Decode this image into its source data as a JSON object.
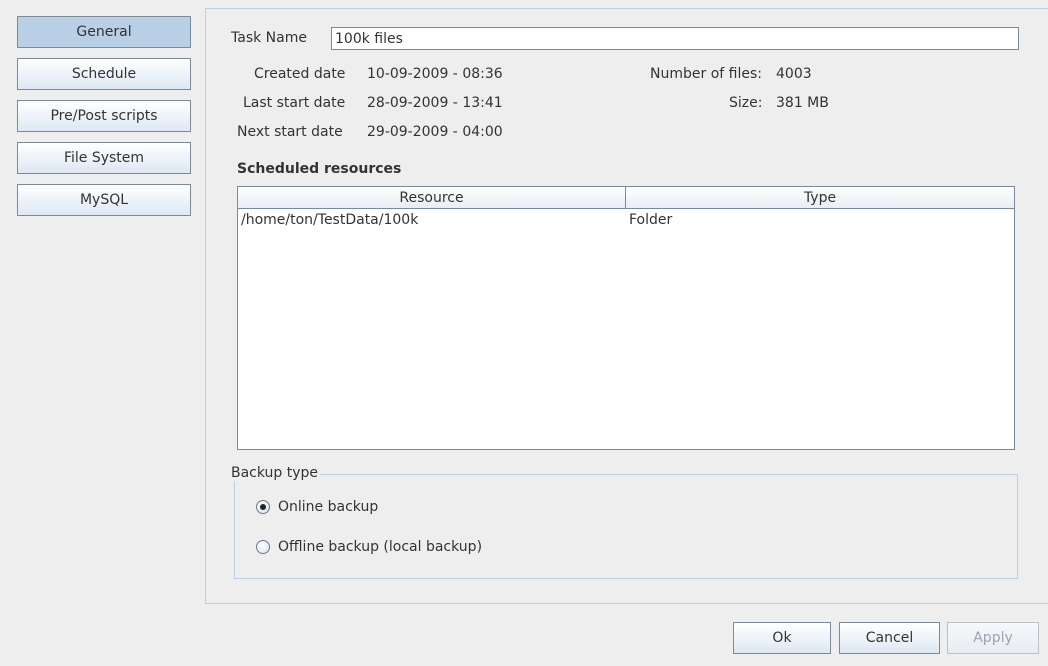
{
  "sidebar": {
    "items": [
      {
        "label": "General",
        "active": true
      },
      {
        "label": "Schedule",
        "active": false
      },
      {
        "label": "Pre/Post scripts",
        "active": false
      },
      {
        "label": "File System",
        "active": false
      },
      {
        "label": "MySQL",
        "active": false
      }
    ]
  },
  "general": {
    "task_name_label": "Task Name",
    "task_name_value": "100k files",
    "created_label": "Created date",
    "created_value": "10-09-2009 - 08:36",
    "last_start_label": "Last start date",
    "last_start_value": "28-09-2009 - 13:41",
    "next_start_label": "Next start date",
    "next_start_value": "29-09-2009 - 04:00",
    "num_files_label": "Number of files:",
    "num_files_value": "4003",
    "size_label": "Size:",
    "size_value": "381 MB"
  },
  "resources": {
    "title": "Scheduled resources",
    "columns": [
      "Resource",
      "Type"
    ],
    "rows": [
      {
        "resource": "/home/ton/TestData/100k",
        "type": "Folder"
      }
    ]
  },
  "backup_type": {
    "legend": "Backup type",
    "options": [
      {
        "label": "Online backup",
        "selected": true
      },
      {
        "label": "Offline backup (local backup)",
        "selected": false
      }
    ]
  },
  "buttons": {
    "ok": "Ok",
    "cancel": "Cancel",
    "apply": "Apply"
  },
  "colors": {
    "accent": "#b8cfe5",
    "border": "#7a8a99",
    "background": "#eeeeee"
  }
}
